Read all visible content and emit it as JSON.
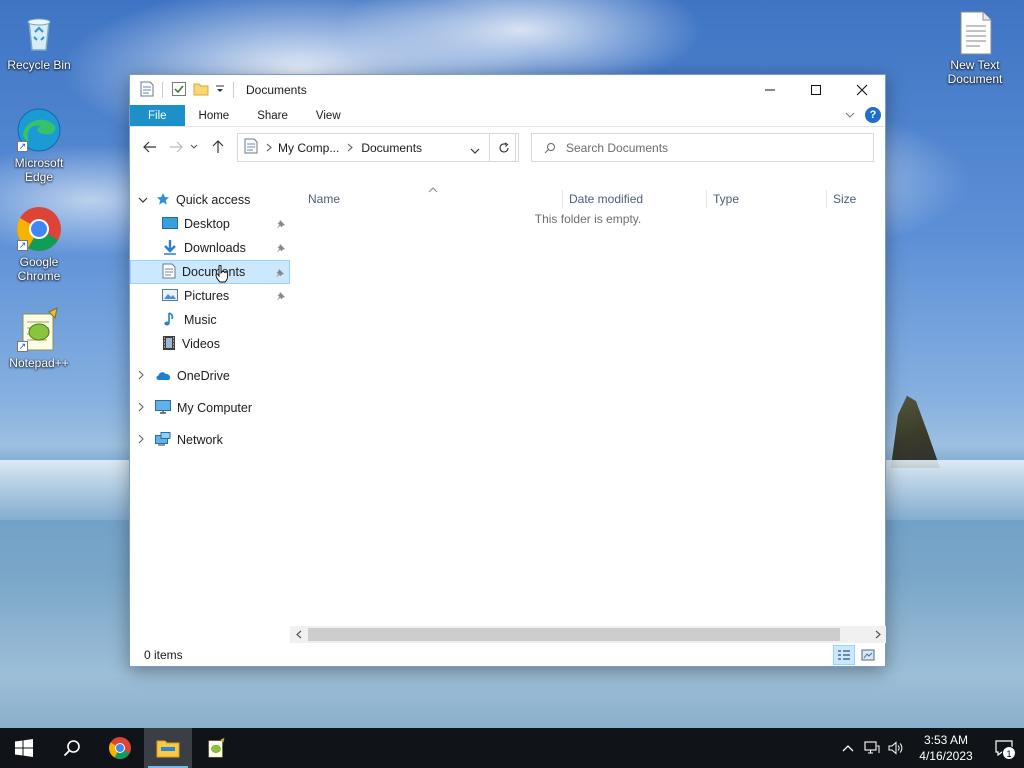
{
  "desktop": {
    "icons": [
      {
        "label": "Recycle Bin",
        "icon": "recycle-bin-icon"
      },
      {
        "label": "Microsoft Edge",
        "icon": "edge-icon"
      },
      {
        "label": "Google Chrome",
        "icon": "chrome-icon"
      },
      {
        "label": "Notepad++",
        "icon": "notepadpp-icon"
      },
      {
        "label": "New Text Document",
        "icon": "text-document-icon"
      }
    ]
  },
  "explorer": {
    "title": "Documents",
    "window_controls": {
      "minimize": "minimize-icon",
      "maximize": "maximize-icon",
      "close": "close-icon"
    },
    "ribbon": {
      "tabs": [
        "File",
        "Home",
        "Share",
        "View"
      ],
      "accent": "#1e90c8",
      "help_glyph": "?"
    },
    "address": {
      "crumbs": [
        "My Comp...",
        "Documents"
      ],
      "search_placeholder": "Search Documents"
    },
    "nav": {
      "quick_access": "Quick access",
      "pinned": [
        {
          "label": "Desktop",
          "pinned": true
        },
        {
          "label": "Downloads",
          "pinned": true
        },
        {
          "label": "Documents",
          "pinned": true,
          "selected": true
        },
        {
          "label": "Pictures",
          "pinned": true
        },
        {
          "label": "Music",
          "pinned": false
        },
        {
          "label": "Videos",
          "pinned": false
        }
      ],
      "roots": [
        "OneDrive",
        "My Computer",
        "Network"
      ]
    },
    "columns": [
      "Name",
      "Date modified",
      "Type",
      "Size"
    ],
    "empty_message": "This folder is empty.",
    "status": "0 items",
    "selection_color": "#cce8ff"
  },
  "taskbar": {
    "pinned": [
      "start-icon",
      "search-icon",
      "chrome-icon",
      "file-explorer-icon",
      "notepadpp-icon"
    ],
    "active": "file-explorer-icon",
    "clock": {
      "time": "3:53 AM",
      "date": "4/16/2023"
    },
    "notification_count": "1"
  }
}
